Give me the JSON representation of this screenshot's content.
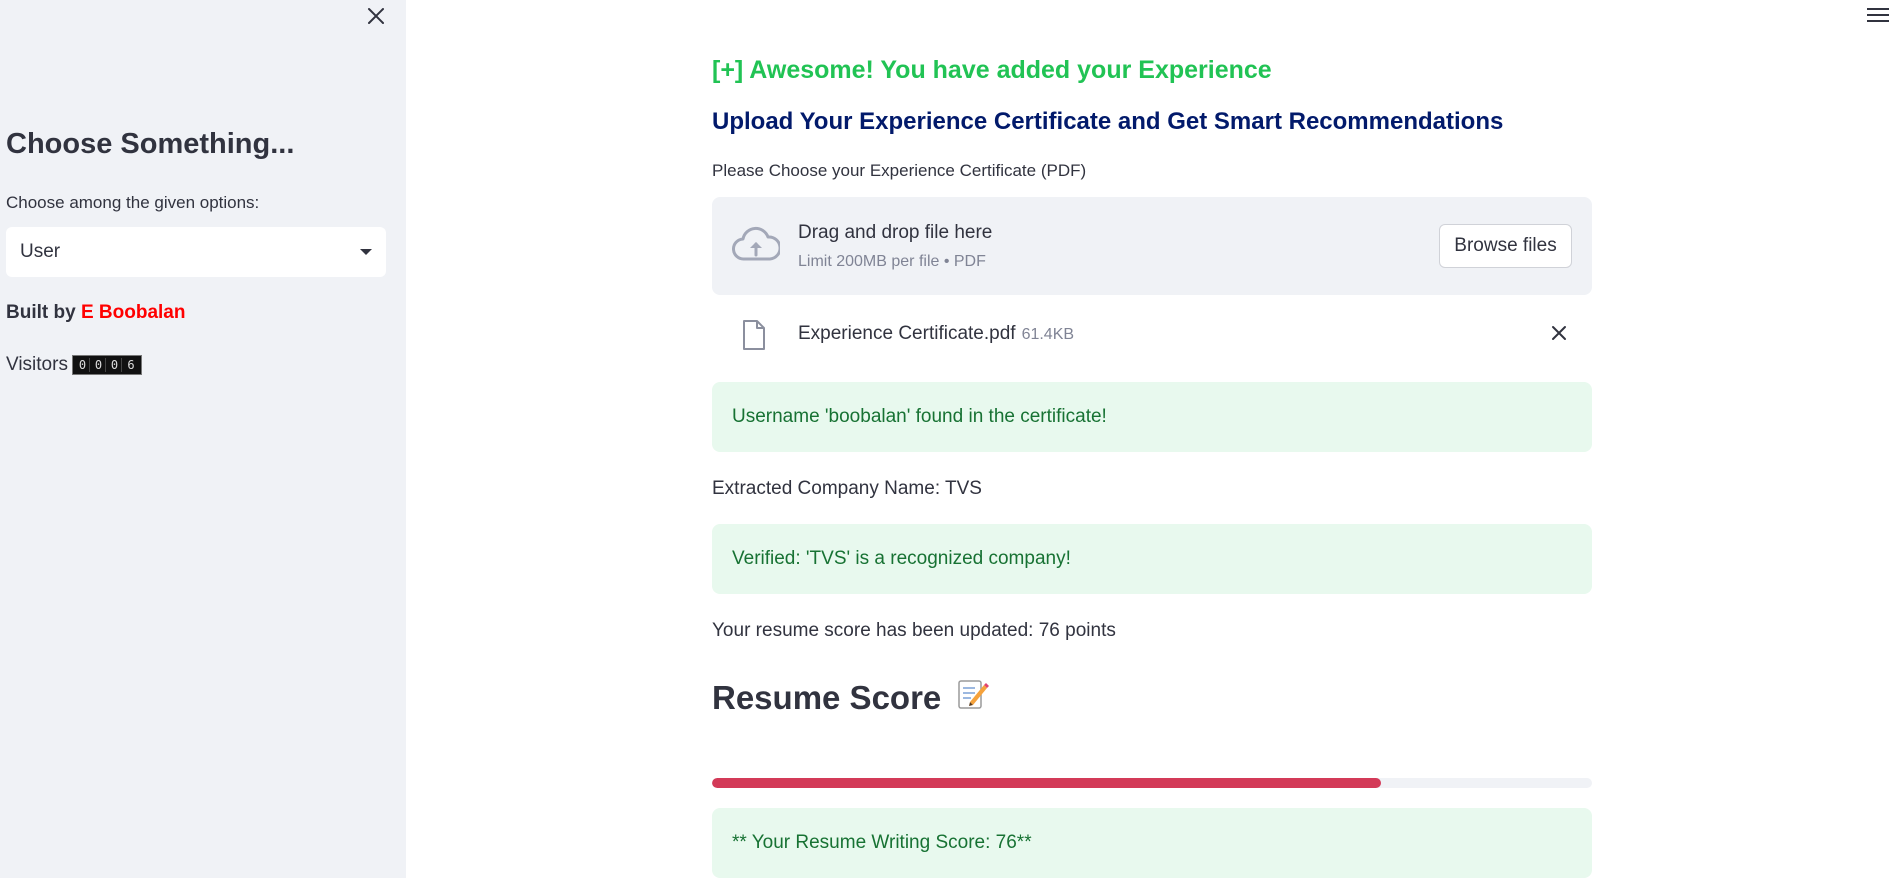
{
  "sidebar": {
    "title": "Choose Something...",
    "select_label": "Choose among the given options:",
    "select_value": "User",
    "built_by_prefix": "Built by ",
    "author": "E Boobalan",
    "visitors_label": "Visitors",
    "visitor_digits": [
      "0",
      "0",
      "0",
      "6"
    ]
  },
  "main": {
    "success_heading": "[+] Awesome! You have added your Experience",
    "upload_heading": "Upload Your Experience Certificate and Get Smart Recommendations",
    "uploader_label": "Please Choose your Experience Certificate (PDF)",
    "dropzone": {
      "title": "Drag and drop file here",
      "limit": "Limit 200MB per file • PDF",
      "browse_label": "Browse files"
    },
    "file": {
      "name": "Experience Certificate.pdf",
      "size": "61.4KB"
    },
    "username_alert": "Username 'boobalan' found in the certificate!",
    "company_line": "Extracted Company Name: TVS",
    "verified_alert": "Verified: 'TVS' is a recognized company!",
    "score_updated_line": "Your resume score has been updated: 76 points",
    "score_heading": "Resume Score",
    "score_progress_percent": 76,
    "score_alert": "** Your Resume Writing Score: 76**"
  },
  "colors": {
    "success_green": "#21c354",
    "heading_navy": "#021a6b",
    "author_red": "#ff0000",
    "progress_red": "#d33a58",
    "alert_bg": "#e8f9ee",
    "alert_text": "#177233",
    "sidebar_bg": "#f0f2f6"
  },
  "icons": {
    "sidebar_close": "close-icon",
    "menu": "hamburger-menu-icon",
    "upload": "cloud-upload-icon",
    "file": "file-icon",
    "remove_file": "close-icon",
    "score_heading": "memo-icon"
  }
}
